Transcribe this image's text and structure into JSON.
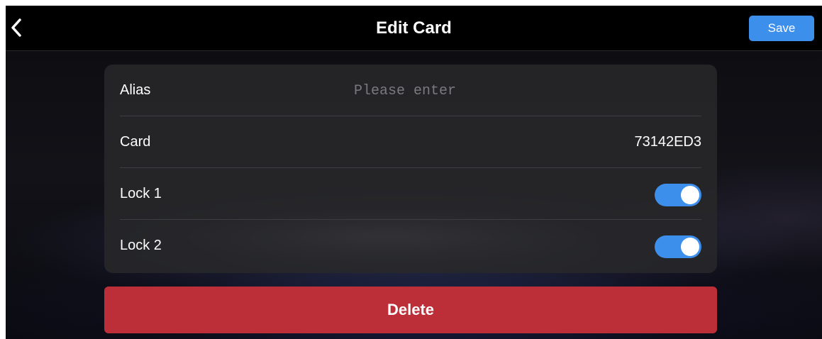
{
  "header": {
    "title": "Edit Card",
    "back_icon": "chevron-left-icon",
    "save_label": "Save"
  },
  "form": {
    "alias": {
      "label": "Alias",
      "value": "",
      "placeholder": "Please enter"
    },
    "card": {
      "label": "Card",
      "value": "73142ED3"
    },
    "lock1": {
      "label": "Lock 1",
      "enabled": true
    },
    "lock2": {
      "label": "Lock 2",
      "enabled": true
    }
  },
  "delete_label": "Delete",
  "colors": {
    "accent": "#3d8fec",
    "danger": "#bd2f38",
    "panel": "#28282a",
    "background": "#000000"
  }
}
